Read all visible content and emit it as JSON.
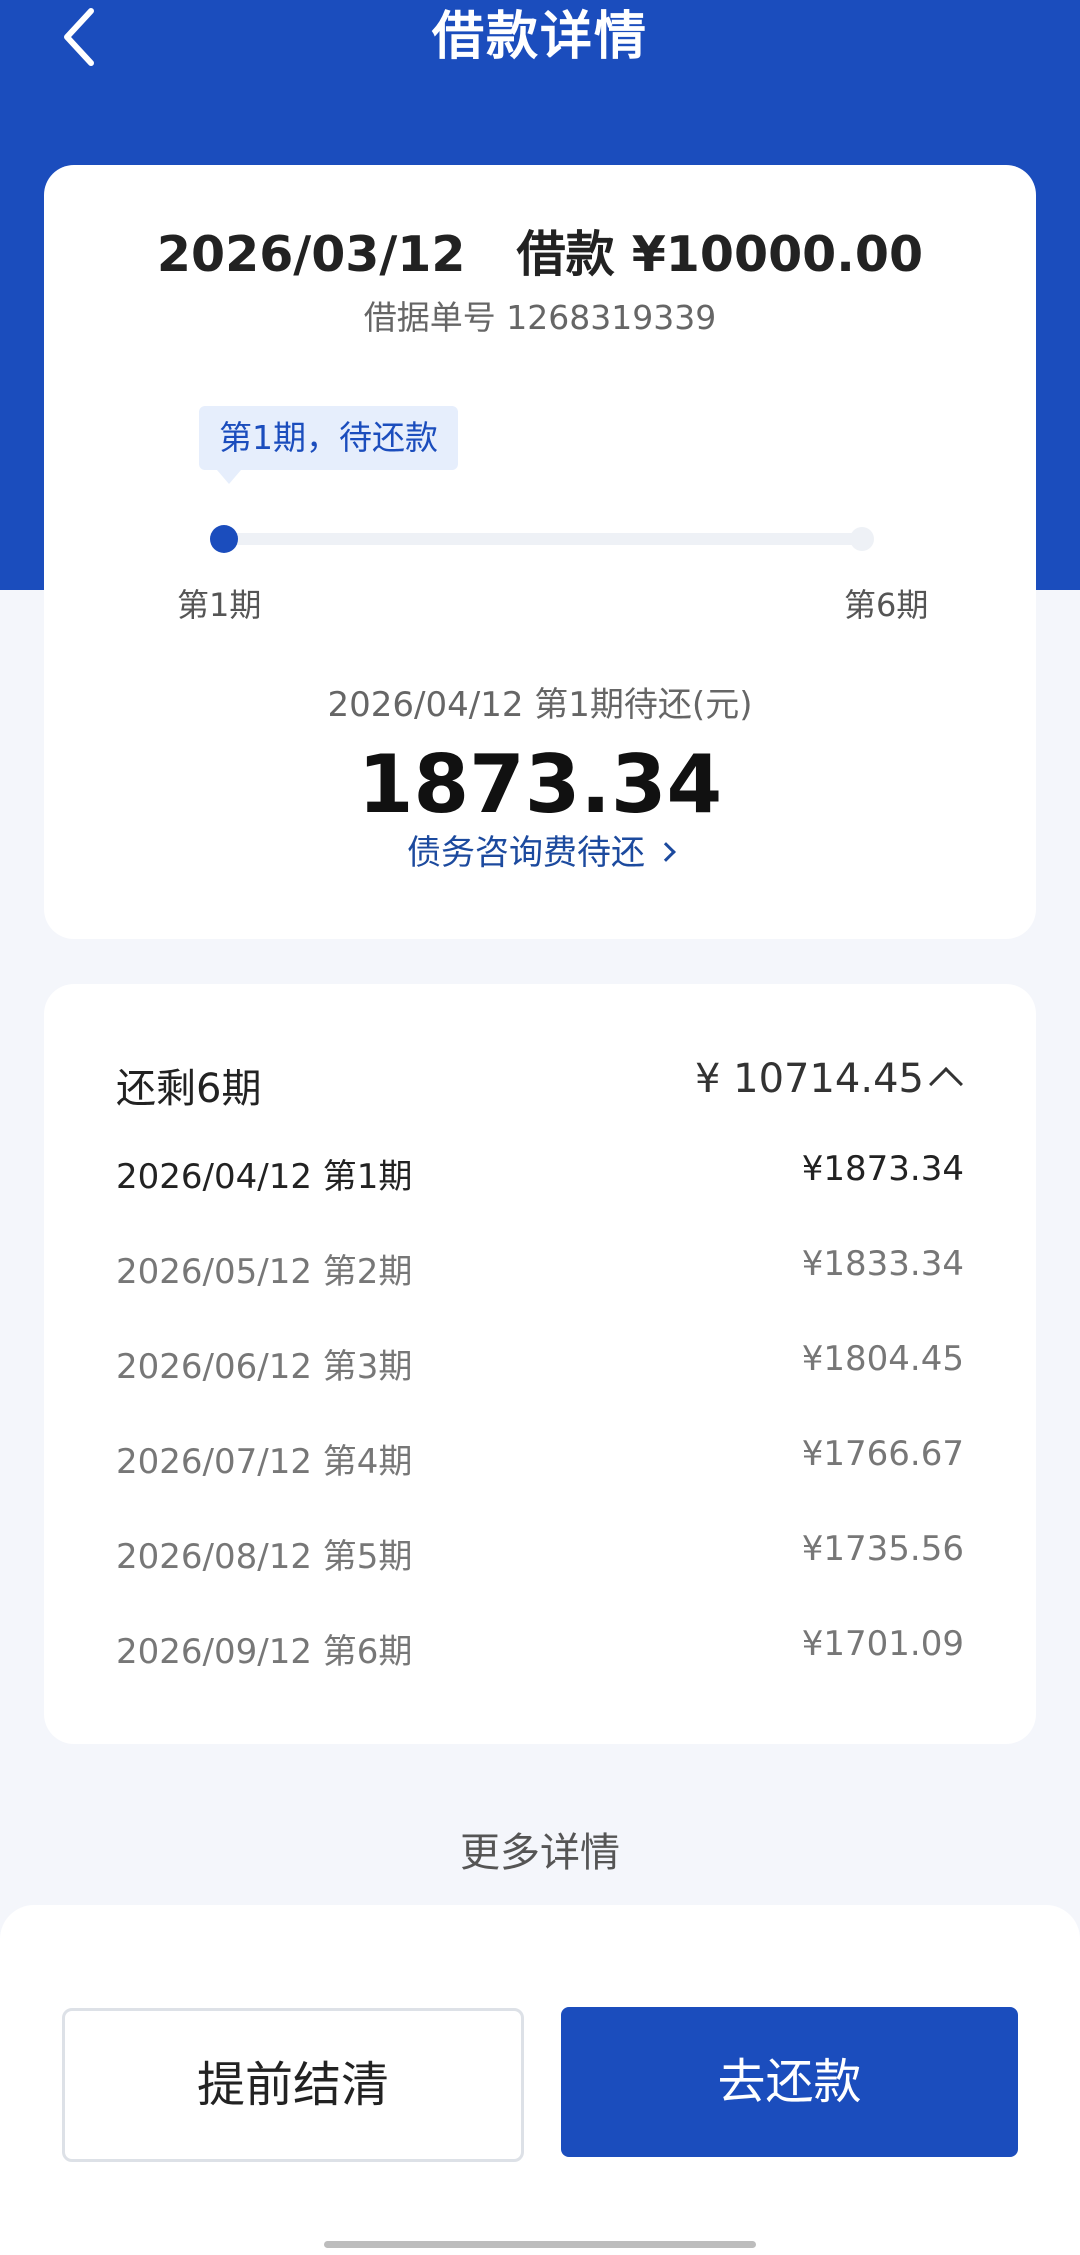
{
  "header": {
    "title": "借款详情",
    "back_icon": "chevron-left-icon",
    "background": "#1b4dbd"
  },
  "loan": {
    "headline": "2026/03/12   借款 ¥10000.00",
    "receipt_no": "借据单号 1268319339",
    "period_tip": "第1期，待还款",
    "progress": {
      "current": 1,
      "total": 6,
      "fraction": 0.0
    },
    "label_start": "第1期",
    "label_end": "第6期",
    "due_note": "2026/04/12 第1期待还(元)",
    "due_amount": "1873.34",
    "fee_link": "债务咨询费待还"
  },
  "schedule": {
    "title": "还剩6期",
    "total": "¥ 10714.45",
    "rows": [
      {
        "date": "2026/04/12 第1期",
        "amount": "¥1873.34"
      },
      {
        "date": "2026/05/12 第2期",
        "amount": "¥1833.34"
      },
      {
        "date": "2026/06/12 第3期",
        "amount": "¥1804.45"
      },
      {
        "date": "2026/07/12 第4期",
        "amount": "¥1766.67"
      },
      {
        "date": "2026/08/12 第5期",
        "amount": "¥1735.56"
      },
      {
        "date": "2026/09/12 第6期",
        "amount": "¥1701.09"
      }
    ]
  },
  "more_details": "更多详情",
  "actions": {
    "settle": "提前结清",
    "repay": "去还款"
  },
  "colors": {
    "accent": "#1b4dbd",
    "link": "#1c4a9e",
    "page_bg": "#f4f6fb"
  }
}
